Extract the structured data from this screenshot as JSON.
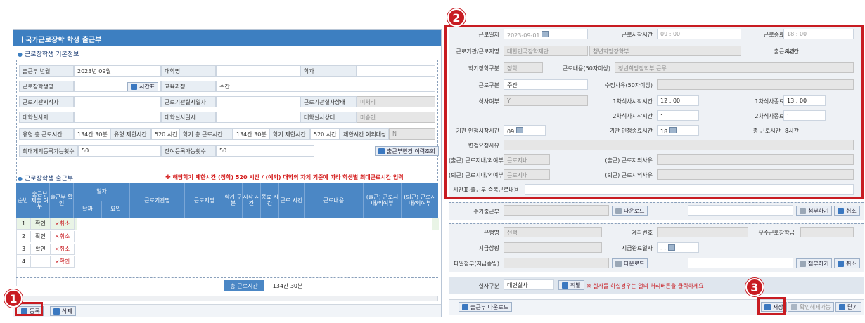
{
  "left": {
    "title": "ㅣ국가근로장학 학생 출근부",
    "section1": "근로장학생 기본정보",
    "section2": "근로장학생 출근부",
    "info_rows": [
      {
        "l1": "출근부 년월",
        "v1": "2023년 09월",
        "l2": "대학명",
        "v2": "",
        "l3": "학과",
        "v3": ""
      },
      {
        "l1": "근로장학생명",
        "v1": "",
        "l2": "교육과정",
        "v2": "주간",
        "l3": "",
        "v3": ""
      },
      {
        "l1": "근로기관시작자",
        "v1": "",
        "l2": "근로기관실시일자",
        "v2": "",
        "l3": "근로기관실사상태",
        "v3": "미처리"
      },
      {
        "l1": "대학실사자",
        "v1": "",
        "l2": "대학실사일시",
        "v2": "",
        "l3": "대학실사상태",
        "v3": "미승인"
      }
    ],
    "time_row": [
      "유형 총 근로시간",
      "134간 30분",
      "유형 제한시간",
      "520 시간",
      "학기 총 근로시간",
      "134간 30분",
      "학기 제한시간",
      "520 시간",
      "제한시간 예외대상",
      "N"
    ],
    "max_row": {
      "l1": "최대제외등록가능횟수",
      "v1": "50",
      "l2": "잔여등록가능횟수",
      "v2": "50"
    },
    "time_btn": "시간표",
    "history_btn": "출근부변경 이력조회",
    "notice": "※ 해당학기 제한시간 (정학) 520 시간 / (예외) 대학의 자체 기준에 따라 학생별 최대근로시간 입력",
    "table_headers": [
      "순번",
      "출근부 제출 여부",
      "출근부 확인",
      "일자",
      "근로기관명",
      "근로지명",
      "학기 구분",
      "시작 시간",
      "종료 시간",
      "근로 시간",
      "근로내용",
      "(출근) 근로지 내/외여부",
      "(퇴근) 근로지 내/외여부"
    ],
    "date_sub": [
      "날짜",
      "요일"
    ],
    "rows": [
      {
        "no": "1",
        "confirm": "확인",
        "cancel": "취소"
      },
      {
        "no": "2",
        "confirm": "확인",
        "cancel": "취소"
      },
      {
        "no": "3",
        "confirm": "확인",
        "cancel": "취소"
      },
      {
        "no": "4",
        "confirm": "",
        "cancel": "확인"
      }
    ],
    "total_label": "총 근로시간",
    "total_value": "134간 30분",
    "register_btn": "등록",
    "delete_btn": "삭제"
  },
  "right": {
    "rows": {
      "work_date_label": "근로일자",
      "work_date_value": "2023-09-01",
      "start_time_label": "근로시작시간",
      "start_time_value": "09   : 00",
      "end_time_label": "근로종료시간",
      "end_time_value": "18   : 00",
      "org_label": "근로기관/근로지명",
      "org_value": "대한민국장학재단",
      "site_value": "청년희망장학부",
      "attend_label": "출근시간",
      "attend_value": "8시간",
      "term_label": "학기정학구분",
      "term_value": "정학",
      "content_label": "근로내용(50자이상)",
      "content_value": "청년희망장학부 근무",
      "shift_label": "근로구분",
      "shift_value": "주간",
      "edit_reason_label": "수정사유(50자이상)",
      "meal_label": "식사여부",
      "meal_value": "Y",
      "meal1_start_label": "1차식사시작시간",
      "meal1_start_value": "12   : 00",
      "meal1_end_label": "1차식사종료시간",
      "meal1_end_value": "13   : 00",
      "meal2_start_label": "2차식사시작시간",
      "meal2_start_value": ":",
      "meal2_end_label": "2차식사종료시간",
      "meal2_end_value": ":",
      "auth_start_label": "기관 인정시작시간",
      "auth_start_value": "09",
      "auth_end_label": "기관 인정종료시간",
      "auth_end_value": "18",
      "total_label": "총 근로시간",
      "total_value": "8시간",
      "change_reason_label": "변경요청사유",
      "in_loc_label": "(출근) 근로지내/외여부",
      "in_loc_value": "근로지내",
      "in_reason_label": "(출근) 근로지외사유",
      "out_loc_label": "(퇴근) 근로지내/외여부",
      "out_loc_value": "근로지내",
      "out_reason_label": "(퇴근) 근로지외사유",
      "dup_label": "시간표-출근부 중복근로내용"
    },
    "manual_label": "수기출근부",
    "download": "다운로드",
    "attach": "첨부하기",
    "cancel_small": "취소",
    "bank_label": "은행명",
    "bank_value": "선택",
    "account_label": "계좌번호",
    "excellent_label": "우수근로장학금",
    "pay_label": "지급상황",
    "pay_date_label": "지급완료일자",
    "pay_date_value": "- -",
    "file_label": "파일첨부(지급증빙)",
    "review_label": "실사구분",
    "review_value": "대면실사",
    "review_btn": "적발",
    "review_note": "※ 실사를 하실경우는 열의 처리버튼을 클릭하세요",
    "attendance_download": "출근부 다운로드",
    "save_btn": "저장",
    "confirm_cancel_btn": "확인해제가능",
    "close_btn": "닫기"
  },
  "badges": [
    "1",
    "2",
    "3"
  ]
}
